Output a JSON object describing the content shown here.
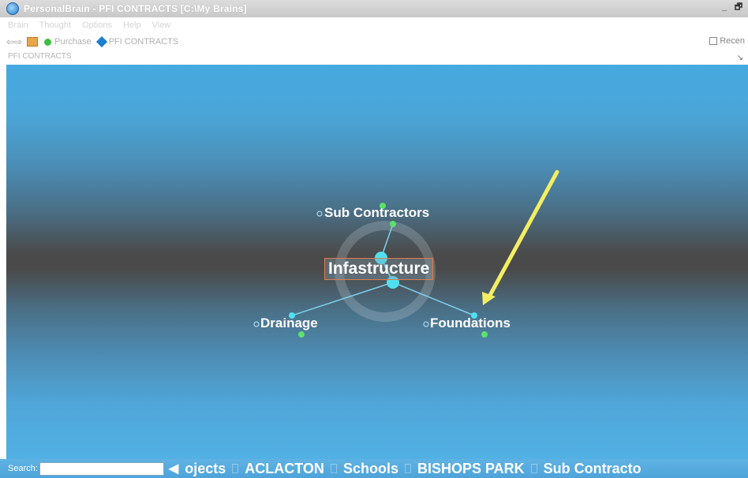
{
  "window": {
    "title": "PersonalBrain - PFI CONTRACTS [C:\\My Brains]",
    "minimize_glyph": "_",
    "restore_glyph": "🗗"
  },
  "menu": [
    "Brain",
    "Thought",
    "Options",
    "Help",
    "View"
  ],
  "toolbar": {
    "back_forward": "⇦⇨",
    "items": [
      "Purchase",
      "PFI CONTRACTS"
    ],
    "recent_label": "Recen"
  },
  "path": {
    "text": "PFI CONTRACTS"
  },
  "brain": {
    "central": "Infastructure",
    "parent": "Sub Contractors",
    "children": [
      "Drainage",
      "Foundations"
    ]
  },
  "annotation": {
    "color": "#f4ee63"
  },
  "bottom": {
    "search_label": "Search:",
    "search_value": "",
    "prev_arrow": "◀",
    "pinned": [
      "ojects",
      "ACLACTON",
      "Schools",
      "BISHOPS PARK",
      "Sub Contracto"
    ]
  },
  "colors": {
    "canvas_top": "#46a9e0",
    "canvas_mid": "#4a4a4a",
    "node": "#4fe0f0",
    "link": "#7fd0ee",
    "green_gate": "#5be26a",
    "central_border": "#e07b4a"
  }
}
